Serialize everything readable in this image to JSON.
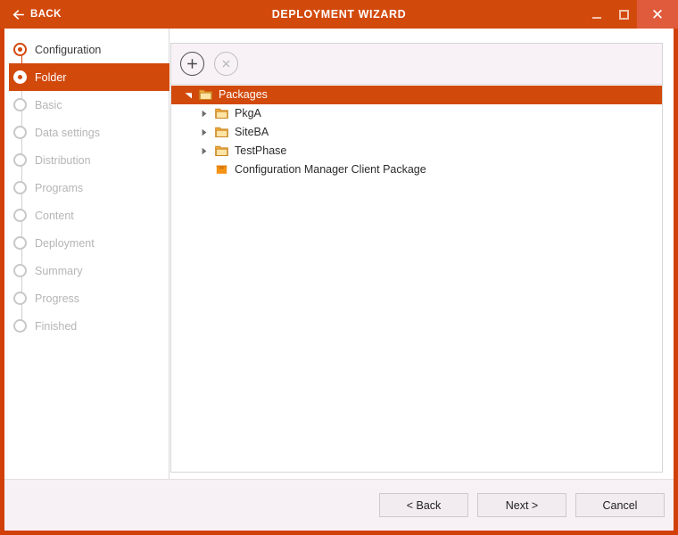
{
  "titlebar": {
    "back_label": "BACK",
    "back_icon": "arrow-left-icon",
    "title": "DEPLOYMENT WIZARD",
    "minimize_icon": "minimize-icon",
    "maximize_icon": "maximize-icon",
    "close_icon": "close-icon",
    "bg_color": "#d2490c",
    "close_bg_color": "#e05a3c"
  },
  "sidebar": {
    "steps": [
      {
        "label": "Configuration",
        "state": "done"
      },
      {
        "label": "Folder",
        "state": "active"
      },
      {
        "label": "Basic",
        "state": "pending"
      },
      {
        "label": "Data settings",
        "state": "pending"
      },
      {
        "label": "Distribution",
        "state": "pending"
      },
      {
        "label": "Programs",
        "state": "pending"
      },
      {
        "label": "Content",
        "state": "pending"
      },
      {
        "label": "Deployment",
        "state": "pending"
      },
      {
        "label": "Summary",
        "state": "pending"
      },
      {
        "label": "Progress",
        "state": "pending"
      },
      {
        "label": "Finished",
        "state": "pending"
      }
    ]
  },
  "toolbar": {
    "add_icon": "plus-circle-icon",
    "add_enabled": true,
    "remove_icon": "close-circle-icon",
    "remove_enabled": false
  },
  "tree": {
    "nodes": [
      {
        "label": "Packages",
        "icon": "folder-icon",
        "twisty": "expanded",
        "depth": 0,
        "selected": true
      },
      {
        "label": "PkgA",
        "icon": "folder-icon",
        "twisty": "collapsed",
        "depth": 1,
        "selected": false
      },
      {
        "label": "SiteBA",
        "icon": "folder-icon",
        "twisty": "collapsed",
        "depth": 1,
        "selected": false
      },
      {
        "label": "TestPhase",
        "icon": "folder-icon",
        "twisty": "collapsed",
        "depth": 1,
        "selected": false
      },
      {
        "label": "Configuration Manager Client Package",
        "icon": "package-icon",
        "twisty": "none",
        "depth": 1,
        "selected": false
      }
    ]
  },
  "footer": {
    "back_label": "< Back",
    "next_label": "Next >",
    "cancel_label": "Cancel"
  },
  "colors": {
    "accent": "#d2490c",
    "accent_light": "#e05a3c",
    "folder_fill": "#fde3a4",
    "folder_tab": "#f0a93c",
    "package_fill": "#f59317",
    "pending_text": "#b5b5b5"
  }
}
